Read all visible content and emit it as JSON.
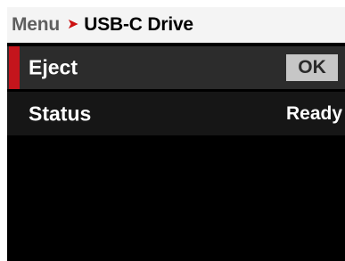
{
  "header": {
    "parent": "Menu",
    "separator_icon": "chevron-right-icon",
    "current": "USB-C Drive"
  },
  "rows": [
    {
      "label": "Eject",
      "action_label": "OK",
      "selected": true
    },
    {
      "label": "Status",
      "value": "Ready",
      "selected": false
    }
  ],
  "colors": {
    "accent": "#c4151c",
    "header_bg": "#f4f4f4",
    "screen_bg": "#000000",
    "selected_row_bg": "#2c2c2c",
    "button_bg": "#c6c6c6"
  }
}
